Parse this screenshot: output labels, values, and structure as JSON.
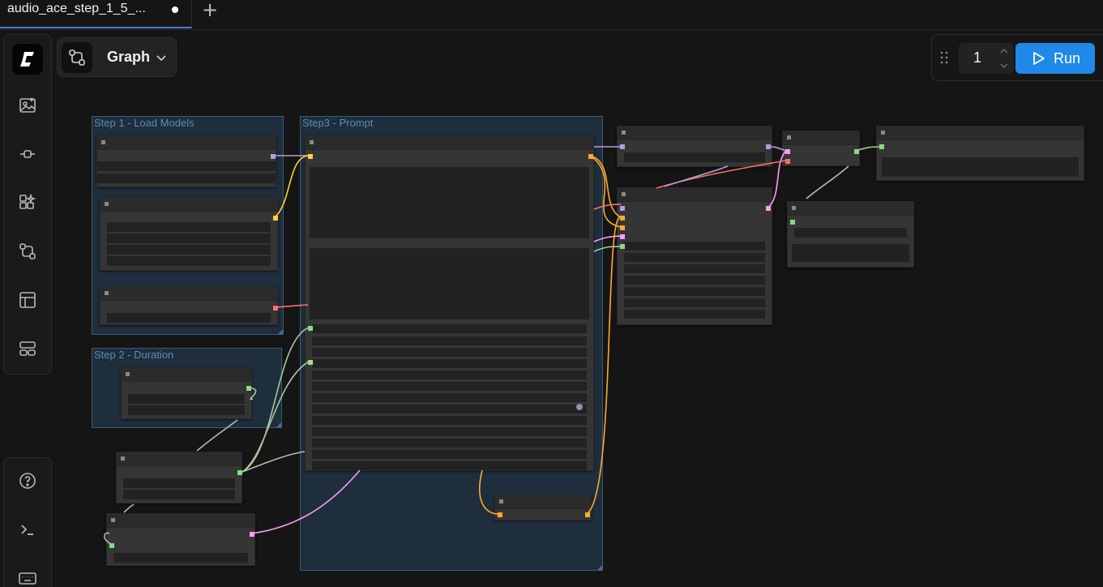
{
  "tabs": [
    {
      "title": "audio_ace_step_1_5_...",
      "unsaved": true
    }
  ],
  "tab_bar": {
    "add_tab_icon": "plus-icon"
  },
  "sidebar": {
    "logo_icon": "comfy-logo-icon",
    "items": [
      {
        "name": "images-icon"
      },
      {
        "name": "models-icon"
      },
      {
        "name": "nodes-icon"
      },
      {
        "name": "workflows-icon"
      },
      {
        "name": "templates-icon"
      },
      {
        "name": "queue-icon"
      }
    ],
    "bottom_items": [
      {
        "name": "help-icon"
      },
      {
        "name": "terminal-icon"
      },
      {
        "name": "keyboard-icon"
      }
    ]
  },
  "mode_selector": {
    "label": "Graph",
    "icon": "graph-icon"
  },
  "run_toolbar": {
    "batch_count": "1",
    "run_label": "Run",
    "run_color": "#1f88e8"
  },
  "groups": [
    {
      "title": "Step 1 - Load Models"
    },
    {
      "title": "Step3 - Prompt"
    },
    {
      "title": "Step 2 - Duration"
    }
  ],
  "colors": {
    "group_fill": "#1f2e3c",
    "node_body": "#353535",
    "link_model": "#b39ddb",
    "link_clip": "#ffd23f",
    "link_vae": "#ff6e6e",
    "link_conditioning": "#ffa931",
    "link_latent": "#ff9cf9",
    "link_int": "#a9c5a0"
  }
}
